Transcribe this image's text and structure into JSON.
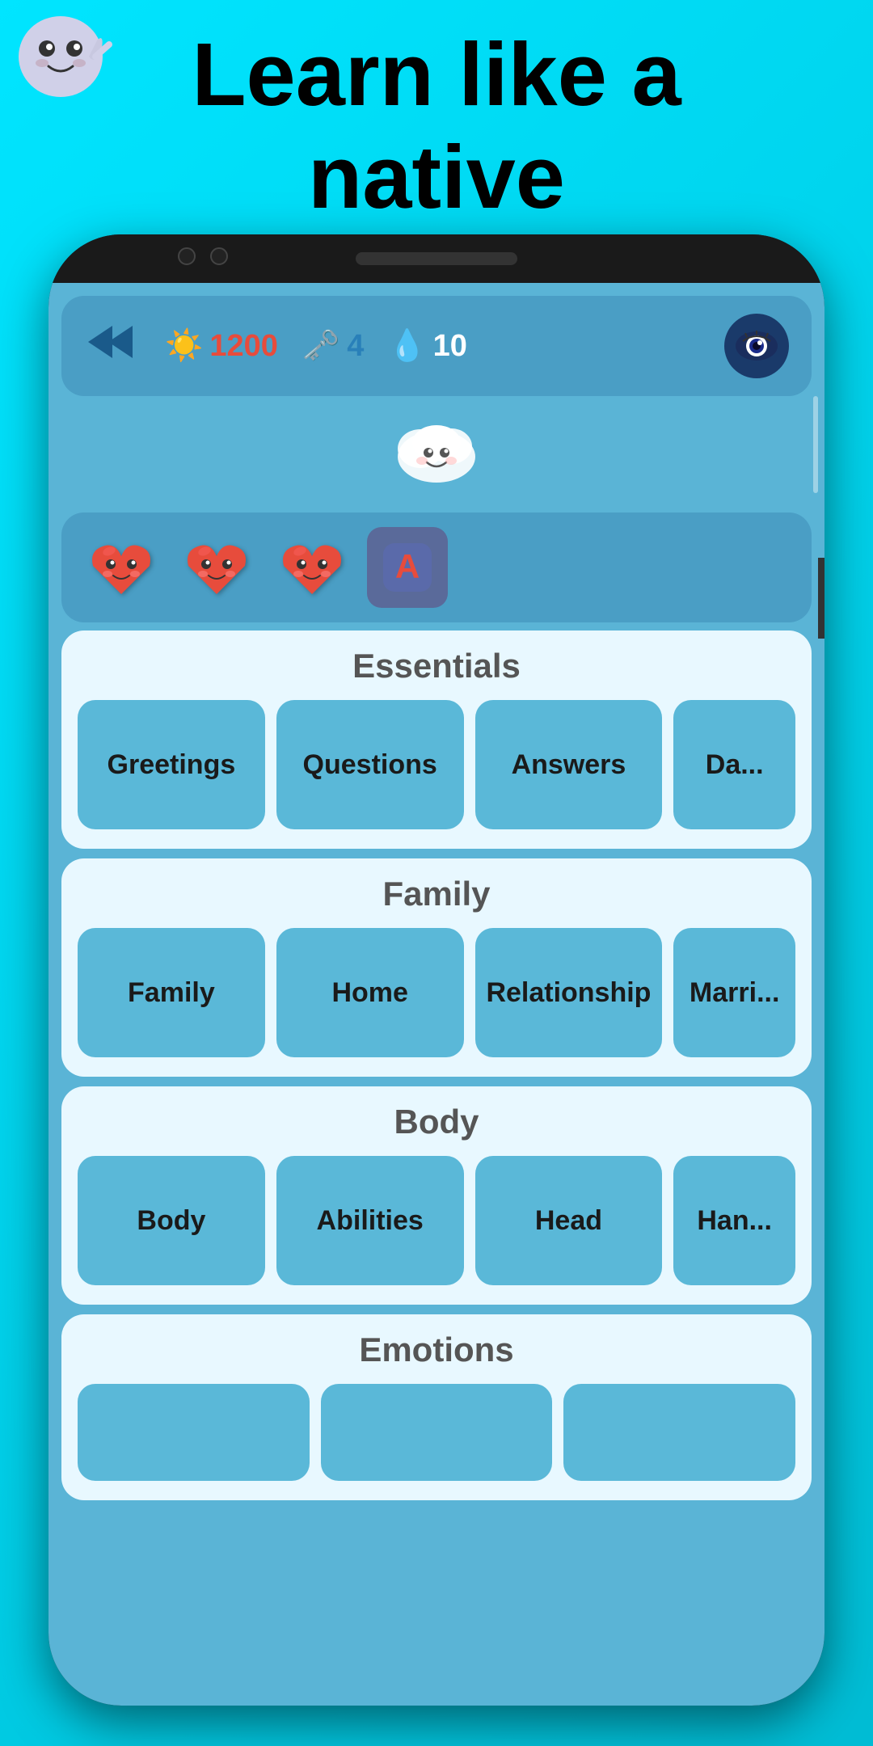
{
  "header": {
    "title_line1": "Learn like a",
    "title_line2": "native"
  },
  "stats": {
    "xp": "1200",
    "keys": "4",
    "lives": "10"
  },
  "hearts": {
    "count": 3,
    "letter": "A"
  },
  "sections": [
    {
      "id": "essentials",
      "title": "Essentials",
      "items": [
        "Greetings",
        "Questions",
        "Answers",
        "Da..."
      ]
    },
    {
      "id": "family",
      "title": "Family",
      "items": [
        "Family",
        "Home",
        "Relationship",
        "Marri..."
      ]
    },
    {
      "id": "body",
      "title": "Body",
      "items": [
        "Body",
        "Abilities",
        "Head",
        "Han..."
      ]
    },
    {
      "id": "emotions",
      "title": "Emotions",
      "items": [
        "...",
        "...",
        "..."
      ]
    }
  ],
  "icons": {
    "back": "⮕",
    "sun": "☀️",
    "key": "🗝️",
    "drop": "💧",
    "eye": "👁️",
    "cloud": "☁️",
    "heart": "❤️"
  }
}
